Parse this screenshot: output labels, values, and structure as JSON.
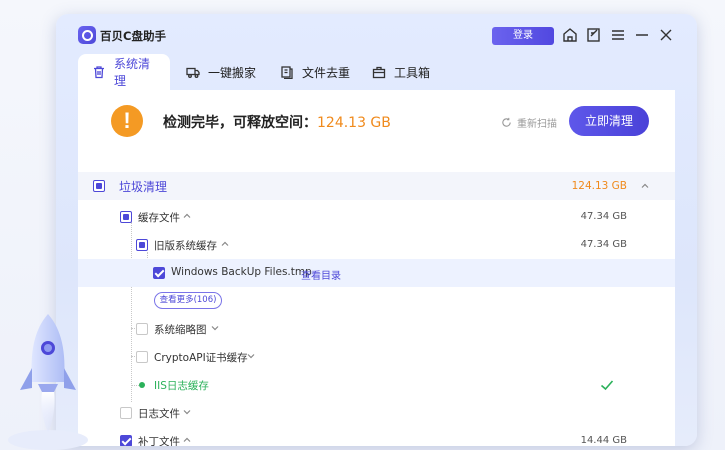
{
  "app": {
    "title": "百贝C盘助手",
    "login_label": "登录"
  },
  "tabs": [
    {
      "label": "系统清理",
      "icon": "trash-icon"
    },
    {
      "label": "一键搬家",
      "icon": "truck-icon"
    },
    {
      "label": "文件去重",
      "icon": "file-copy-icon"
    },
    {
      "label": "工具箱",
      "icon": "toolbox-icon"
    }
  ],
  "summary": {
    "text": "检测完毕，可释放空间：",
    "size": "124.13 GB",
    "rescan_label": "重新扫描",
    "clean_label": "立即清理"
  },
  "tree": {
    "junk": {
      "label": "垃圾清理",
      "size": "124.13 GB"
    },
    "cache": {
      "label": "缓存文件",
      "size": "47.34 GB"
    },
    "old_cache": {
      "label": "旧版系统缓存",
      "size": "47.34 GB"
    },
    "backup_file": {
      "label": "Windows BackUp Files.tmp",
      "link": "查看目录"
    },
    "more_label": "查看更多(106)",
    "thumbnails": {
      "label": "系统缩略图"
    },
    "crypto": {
      "label": "CryptoAPI证书缓存"
    },
    "iis": {
      "label": "IIS日志缓存"
    },
    "logs": {
      "label": "日志文件"
    },
    "patches": {
      "label": "补丁文件",
      "size": "14.44 GB"
    }
  },
  "colors": {
    "accent": "#4d48d8",
    "warning": "#f49a24",
    "size_orange": "#f08a1c",
    "success": "#2bb15a"
  }
}
